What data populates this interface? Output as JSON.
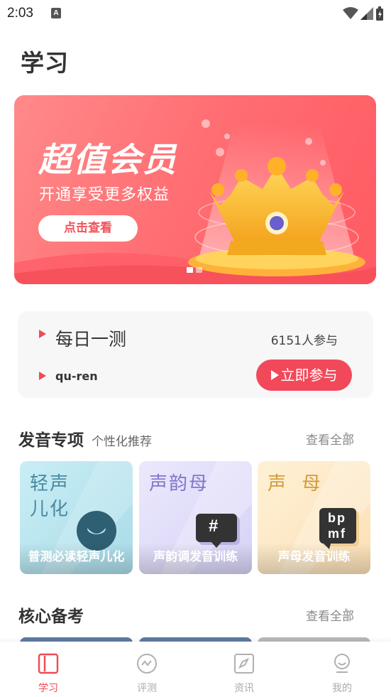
{
  "status_bar": {
    "time": "2:03",
    "notification_icon": "A"
  },
  "page": {
    "title": "学习"
  },
  "banner": {
    "title": "超值会员",
    "subtitle": "开通享受更多权益",
    "button_label": "点击查看",
    "slide_count": 2,
    "active_slide": 1
  },
  "daily": {
    "title": "每日一测",
    "participants": "6151人参与",
    "word": "qu-ren",
    "join_label": "立即参与"
  },
  "pronunciation": {
    "title": "发音专项",
    "subtitle": "个性化推荐",
    "see_all": "查看全部",
    "tiles": [
      {
        "big": "轻声\n儿化",
        "caption": "普测必读轻声儿化",
        "icon": "speech-bubble-icon"
      },
      {
        "big": "声韵母",
        "caption": "声韵调发音训练",
        "icon": "hash-bubble-icon",
        "badge": "#"
      },
      {
        "big": "声  母",
        "caption": "声母发音训练",
        "icon": "bpmf-bubble-icon",
        "badge_line1": "bp",
        "badge_line2": "mf"
      }
    ]
  },
  "core": {
    "title": "核心备考",
    "see_all": "查看全部"
  },
  "tabbar": {
    "tabs": [
      {
        "label": "学习",
        "icon": "book-icon",
        "active": true
      },
      {
        "label": "评测",
        "icon": "wave-circle-icon",
        "active": false
      },
      {
        "label": "资讯",
        "icon": "compass-icon",
        "active": false
      },
      {
        "label": "我的",
        "icon": "person-icon",
        "active": false
      }
    ]
  },
  "colors": {
    "accent": "#f04a55",
    "banner": "#ff6f73",
    "tile1": "#bde6ef",
    "tile2": "#e3e1fb",
    "tile3": "#fde9c8"
  }
}
